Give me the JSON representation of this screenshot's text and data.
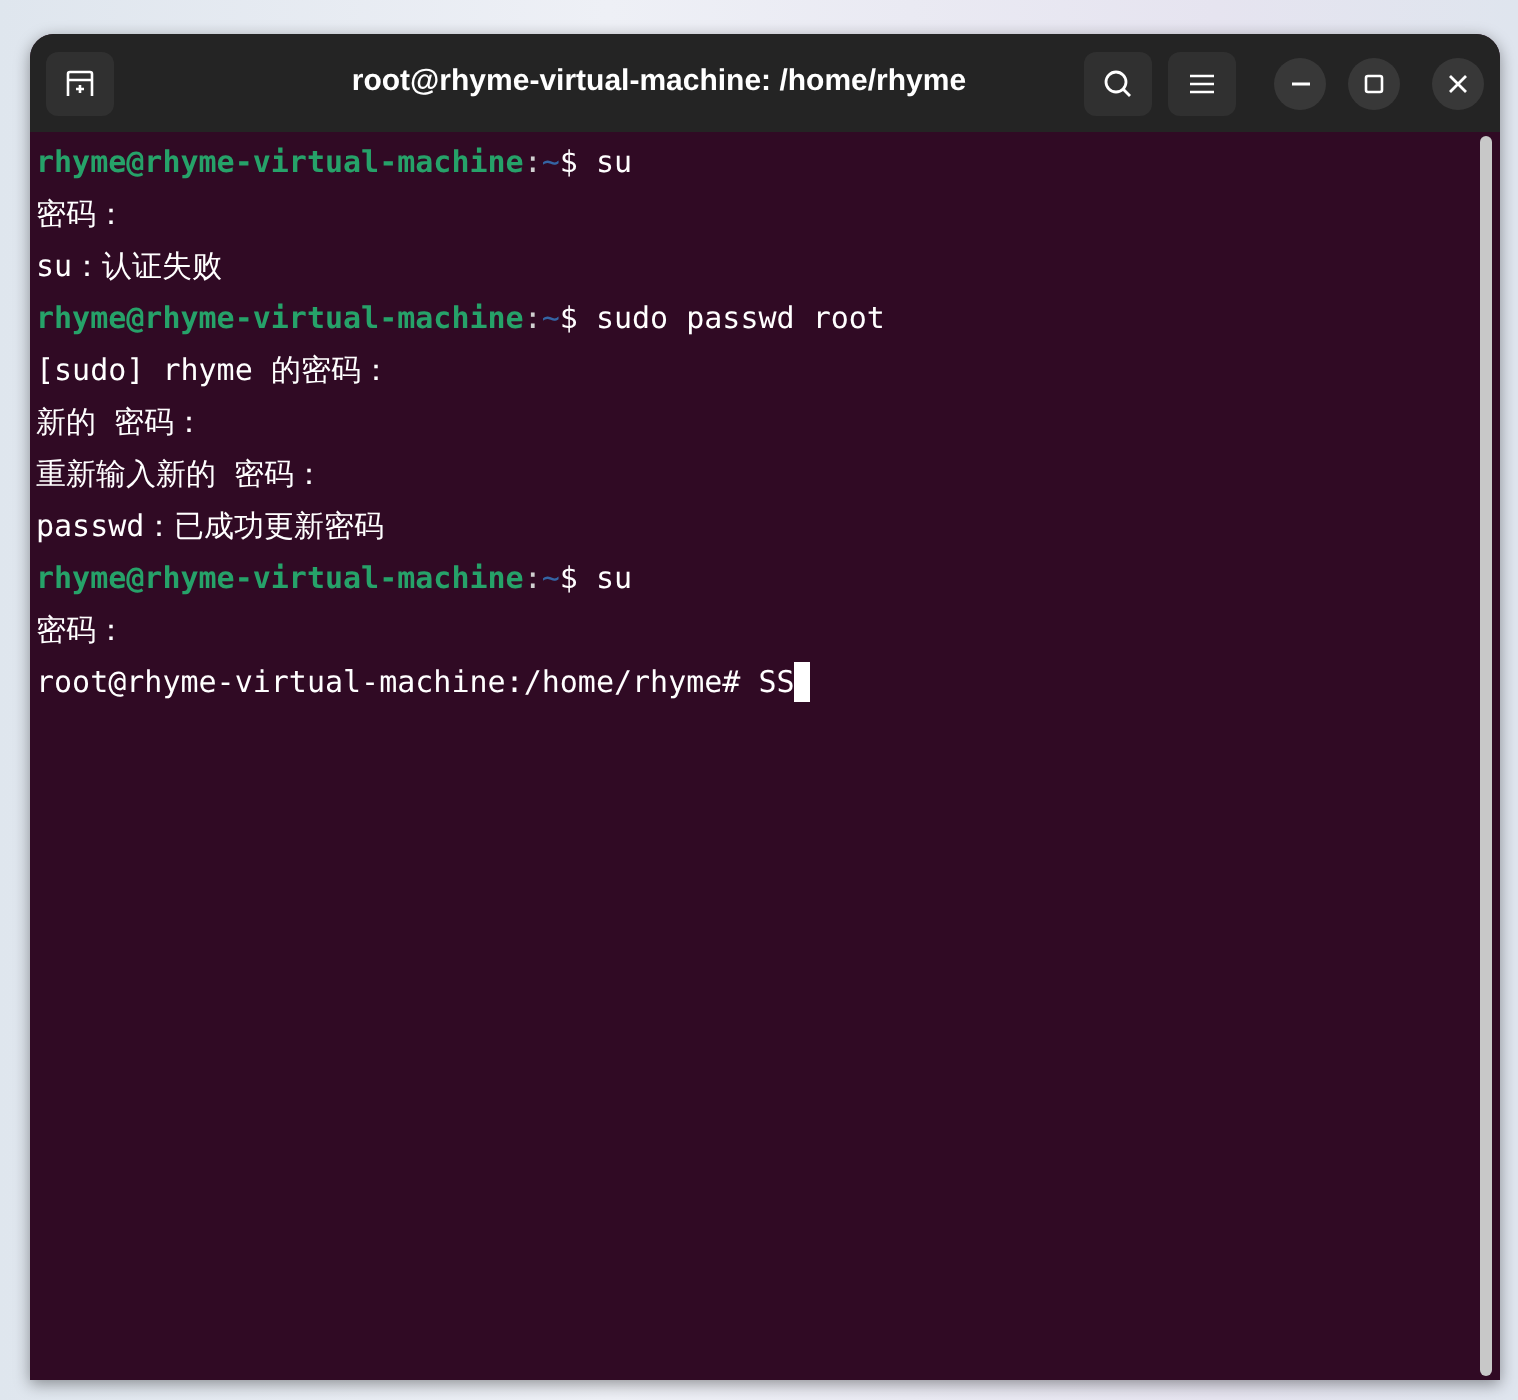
{
  "window": {
    "title": "root@rhyme-virtual-machine: /home/rhyme"
  },
  "terminal": {
    "lines": [
      {
        "kind": "prompt",
        "user_host": "rhyme@rhyme-virtual-machine",
        "separator": ":",
        "path": "~",
        "symbol": "$",
        "command": "su"
      },
      {
        "kind": "output",
        "text": "密码："
      },
      {
        "kind": "output",
        "text": "su：认证失败"
      },
      {
        "kind": "prompt",
        "user_host": "rhyme@rhyme-virtual-machine",
        "separator": ":",
        "path": "~",
        "symbol": "$",
        "command": "sudo passwd root"
      },
      {
        "kind": "output",
        "text": "[sudo] rhyme 的密码："
      },
      {
        "kind": "output",
        "text": "新的 密码："
      },
      {
        "kind": "output",
        "text": "重新输入新的 密码："
      },
      {
        "kind": "output",
        "text": "passwd：已成功更新密码"
      },
      {
        "kind": "prompt",
        "user_host": "rhyme@rhyme-virtual-machine",
        "separator": ":",
        "path": "~",
        "symbol": "$",
        "command": "su"
      },
      {
        "kind": "output",
        "text": "密码："
      },
      {
        "kind": "root_prompt",
        "text": "root@rhyme-virtual-machine:/home/rhyme#",
        "command": "SS"
      }
    ]
  }
}
